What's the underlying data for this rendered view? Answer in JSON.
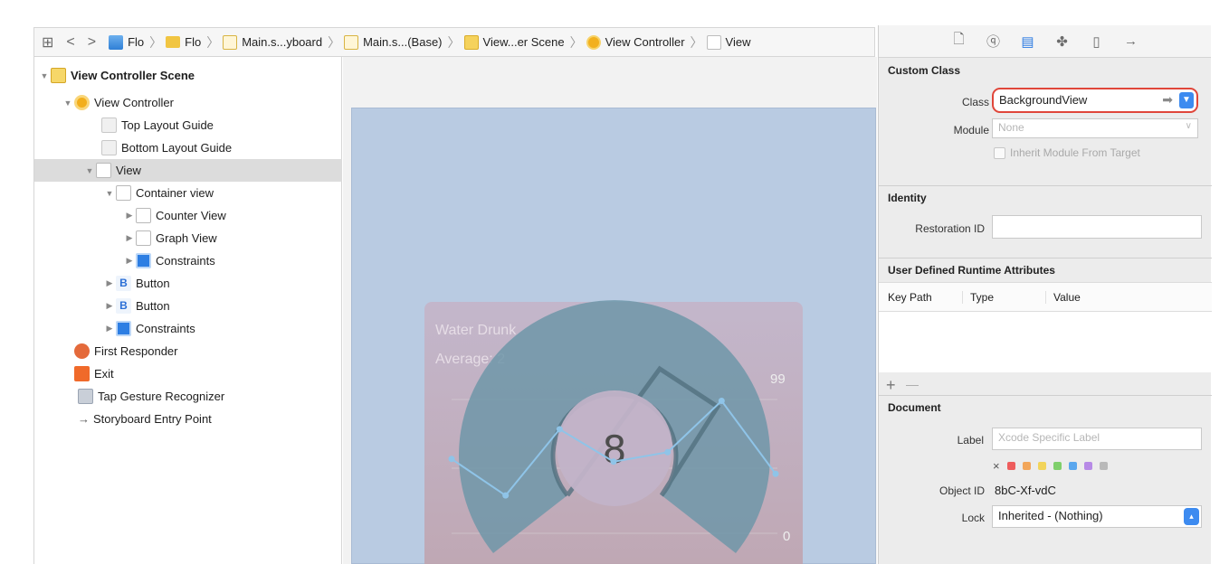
{
  "jumpbar": {
    "nav_back": "<",
    "nav_forward": ">",
    "crumbs": [
      {
        "label": "Flo",
        "icon": "project-icon"
      },
      {
        "label": "Flo",
        "icon": "folder-icon"
      },
      {
        "label": "Main.s...yboard",
        "icon": "storyboard-icon"
      },
      {
        "label": "Main.s...(Base)",
        "icon": "storyboard-icon"
      },
      {
        "label": "View...er Scene",
        "icon": "scene-icon"
      },
      {
        "label": "View Controller",
        "icon": "view-controller-icon"
      },
      {
        "label": "View",
        "icon": "view-icon"
      }
    ]
  },
  "outline": {
    "rows": [
      {
        "label": "View Controller Scene"
      },
      {
        "label": "View Controller"
      },
      {
        "label": "Top Layout Guide"
      },
      {
        "label": "Bottom Layout Guide"
      },
      {
        "label": "View"
      },
      {
        "label": "Container view"
      },
      {
        "label": "Counter View"
      },
      {
        "label": "Graph View"
      },
      {
        "label": "Constraints"
      },
      {
        "label": "Button"
      },
      {
        "label": "Button"
      },
      {
        "label": "Constraints"
      },
      {
        "label": "First Responder"
      },
      {
        "label": "Exit"
      },
      {
        "label": "Tap Gesture Recognizer"
      },
      {
        "label": "Storyboard Entry Point"
      }
    ],
    "button_icon_letter": "B"
  },
  "canvas": {
    "graph_title": "Water Drunk",
    "graph_average": "Average: 2",
    "graph_max": "99",
    "graph_min": "0",
    "counter_value": "8",
    "colors": {
      "background": "#b9cbe2",
      "graph_top": "#c5b3c7",
      "graph_bottom": "#c0a1ab",
      "counter": "#6f96a8"
    }
  },
  "inspector": {
    "custom_class": {
      "title": "Custom Class",
      "class_label": "Class",
      "class_value": "BackgroundView",
      "module_label": "Module",
      "module_placeholder": "None",
      "inherit_label": "Inherit Module From Target"
    },
    "identity": {
      "title": "Identity",
      "restoration_label": "Restoration ID",
      "restoration_value": ""
    },
    "runtime_attributes": {
      "title": "User Defined Runtime Attributes",
      "columns": [
        "Key Path",
        "Type",
        "Value"
      ],
      "add": "+",
      "remove": "—"
    },
    "document": {
      "title": "Document",
      "label_label": "Label",
      "label_placeholder": "Xcode Specific Label",
      "clear_color": "×",
      "label_colors": [
        "#ee5d5d",
        "#f2a65a",
        "#f2d45a",
        "#7fcf6b",
        "#5aa7ee",
        "#b78ae6",
        "#b9b9b9"
      ],
      "object_id_label": "Object ID",
      "object_id_value": "8bC-Xf-vdC",
      "lock_label": "Lock",
      "lock_value": "Inherited - (Nothing)"
    }
  },
  "chart_data": {
    "type": "line",
    "x": [
      1,
      2,
      3,
      4,
      5,
      6,
      7
    ],
    "values": [
      55,
      28,
      77,
      53,
      60,
      98,
      44
    ],
    "ylim": [
      0,
      99
    ]
  }
}
